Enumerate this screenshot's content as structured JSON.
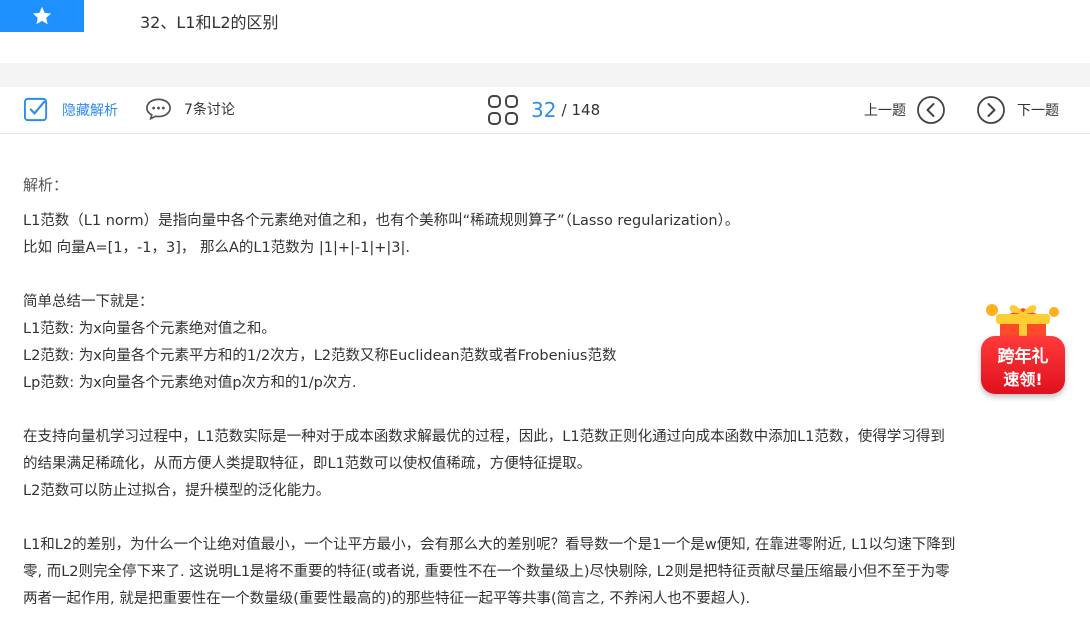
{
  "header": {
    "title": "32、L1和L2的区别"
  },
  "toolbar": {
    "hide_analysis": "隐藏解析",
    "discussion": "7条讨论",
    "current_page": "32",
    "separator": "/",
    "total_pages": "148",
    "prev": "上一题",
    "next": "下一题"
  },
  "content": {
    "heading": "解析：",
    "lines": [
      "L1范数（L1 norm）是指向量中各个元素绝对值之和，也有个美称叫“稀疏规则算子”（Lasso regularization）。",
      "比如 向量A=[1，-1，3]， 那么A的L1范数为 |1|+|-1|+|3|.",
      "",
      "简单总结一下就是：",
      "L1范数: 为x向量各个元素绝对值之和。",
      "L2范数: 为x向量各个元素平方和的1/2次方，L2范数又称Euclidean范数或者Frobenius范数",
      "Lp范数: 为x向量各个元素绝对值p次方和的1/p次方.",
      "",
      "在支持向量机学习过程中，L1范数实际是一种对于成本函数求解最优的过程，因此，L1范数正则化通过向成本函数中添加L1范数，使得学习得到",
      "的结果满足稀疏化，从而方便人类提取特征，即L1范数可以使权值稀疏，方便特征提取。",
      "L2范数可以防止过拟合，提升模型的泛化能力。",
      "",
      "L1和L2的差别，为什么一个让绝对值最小，一个让平方最小，会有那么大的差别呢？看导数一个是1一个是w便知, 在靠进零附近, L1以匀速下降到",
      "零, 而L2则完全停下来了. 这说明L1是将不重要的特征(或者说, 重要性不在一个数量级上)尽快剔除, L2则是把特征贡献尽量压缩最小但不至于为零",
      "两者一起作用, 就是把重要性在一个数量级(重要性最高的)的那些特征一起平等共事(简言之, 不养闲人也不要超人)."
    ]
  },
  "promo": {
    "line1": "跨年礼",
    "line2": "速领!"
  },
  "colors": {
    "accent": "#2d8cf0",
    "star_bg": "#1e90ff",
    "promo_red": "#e0101e"
  }
}
